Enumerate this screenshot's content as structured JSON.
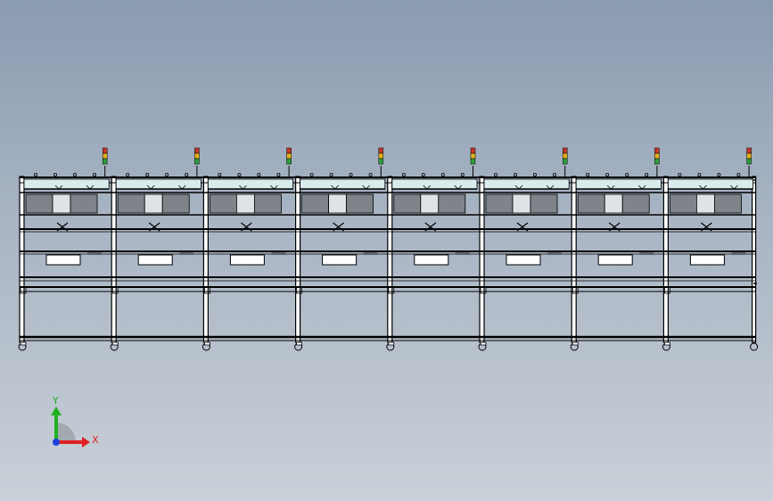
{
  "model_view": {
    "unit_count": 8,
    "signal_lights": [
      "#c0392b",
      "#e0b020",
      "#2e9e3e"
    ],
    "panel_fill": "#7f848a",
    "line_color": "#000000"
  },
  "triad": {
    "x_label": "X",
    "y_label": "Y",
    "x_color": "#e02020",
    "y_color": "#20b020",
    "z_color": "#2040e0"
  }
}
